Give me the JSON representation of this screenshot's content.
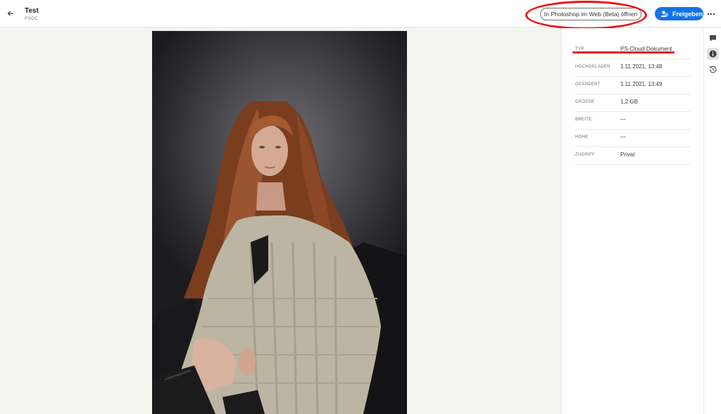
{
  "header": {
    "back_icon": "arrow-left-icon",
    "title": "Test",
    "subtitle": "PSDC",
    "open_in_photoshop_label": "In Photoshop im Web (Beta) öffnen",
    "share_label": "Freigeben",
    "share_icon": "add-user-icon",
    "more_icon": "more-icon",
    "accent_color": "#1473e6",
    "annotation_color": "#ee1111"
  },
  "info": {
    "rows": [
      {
        "label": "TYP",
        "value": "PS-Cloud-Dokument"
      },
      {
        "label": "HOCHGELADEN",
        "value": "1.11.2021, 13:48"
      },
      {
        "label": "GEÄNDERT",
        "value": "1.11.2021, 13:49"
      },
      {
        "label": "GRÖSSE",
        "value": "1,2 GB"
      },
      {
        "label": "BREITE",
        "value": "—"
      },
      {
        "label": "HÖHE",
        "value": "—"
      },
      {
        "label": "ZUGRIFF",
        "value": "Privat"
      }
    ]
  },
  "rail": {
    "icons": [
      "comment-icon",
      "info-icon",
      "history-icon"
    ],
    "active": "info-icon"
  }
}
